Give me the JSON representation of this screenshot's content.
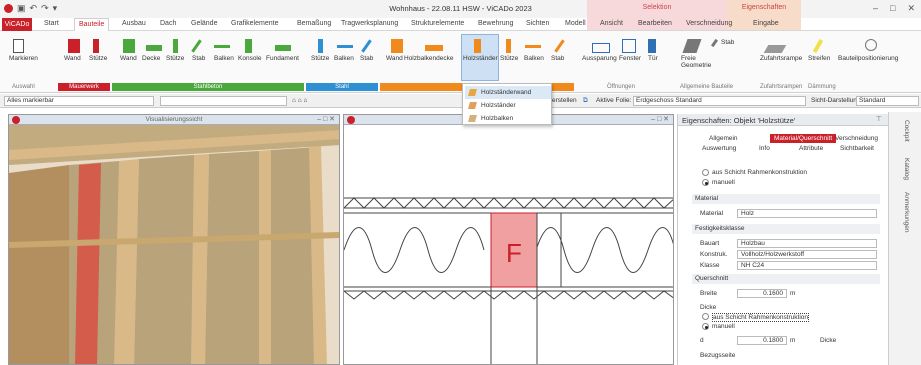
{
  "window": {
    "title": "Wohnhaus - 22.08.11 HSW - ViCADo 2023",
    "controls": [
      "–",
      "□",
      "✕"
    ]
  },
  "qat_icons": [
    "app-logo-icon",
    "save-icon",
    "undo-icon",
    "redo-icon",
    "customize-icon"
  ],
  "context_tabs": {
    "selektion": "Selektion",
    "eigenschaften": "Eigenschaften"
  },
  "tabs": [
    "ViCADo",
    "Start",
    "Bauteile",
    "Ausbau",
    "Dach",
    "Gelände",
    "Grafikelemente",
    "Bemaßung",
    "Tragwerksplanung",
    "Strukturelemente",
    "Bewehrung",
    "Sichten",
    "Modell",
    "Ansicht",
    "Bearbeiten",
    "Verschneidung",
    "Eingabe"
  ],
  "active_tab": "Bauteile",
  "ribbon": {
    "buttons": [
      "Markieren",
      "Wand",
      "Stütze",
      "Wand",
      "Decke",
      "Stütze",
      "Stab",
      "Balken",
      "Konsole",
      "Fundament",
      "Stütze",
      "Balken",
      "Stab",
      "Wand",
      "Holzbalkendecke",
      "Holzständer",
      "Stütze",
      "Balken",
      "Stab",
      "Aussparung",
      "Fenster",
      "Tür",
      "Freie Geometrie",
      "Stab",
      "Zufahrtsrampe",
      "Streifen",
      "Bauteilpositionierung"
    ],
    "groups": [
      "Auswahl",
      "Mauerwerk",
      "Stahlbeton",
      "Stahl",
      "Holz",
      "Öffnungen",
      "Allgemeine Bauteile",
      "Zufahrtsrampen",
      "Dämmung"
    ],
    "group_colors": {
      "mauerwerk": "#c9202a",
      "stahlbeton": "#4aa83c",
      "stahl": "#2f8fd3",
      "holz": "#f08a1c"
    }
  },
  "dropdown": {
    "items": [
      "Holzständerwand",
      "Holzständer",
      "Holzbalken"
    ],
    "highlighted": 0
  },
  "options": {
    "filter": "Alles markierbar",
    "folie_label": "Aktive Folie:",
    "folie_value": "Erdgeschoss Standard",
    "sicht_label": "Sicht-Darstellung:",
    "sicht_value": "Standard",
    "erstellen": "erstellen"
  },
  "pane_left": {
    "title": "Visualisierungssicht"
  },
  "pane_mid": {
    "title": "",
    "label": "F"
  },
  "properties": {
    "title": "Eigenschaften: Objekt 'Holzstütze'",
    "tabs": [
      "Allgemein",
      "Material/Querschnitt",
      "Verschneidung",
      "Auswertung",
      "Info",
      "Attribute",
      "Sichtbarkeit"
    ],
    "active_tab": "Material/Querschnitt",
    "source_options": [
      "aus Schicht Rahmenkonstruktion",
      "manuell"
    ],
    "material_section": "Material",
    "material_label": "Material",
    "material_value": "Holz",
    "festigkeit_section": "Festigkeitsklasse",
    "bauart_label": "Bauart",
    "bauart_value": "Holzbau",
    "konstruk_label": "Konstruk.",
    "konstruk_value": "Vollholz/Holzwerkstoff",
    "klasse_label": "Klasse",
    "klasse_value": "NH C24",
    "querschnitt_section": "Querschnitt",
    "breite_label": "Breite",
    "breite_value": "0.1600",
    "unit": "m",
    "dicke_label": "Dicke",
    "dicke_options": [
      "aus Schicht Rahmenkonstruktion",
      "manuell"
    ],
    "d_label": "d",
    "d_value": "0.1800",
    "d_extra": "Dicke",
    "bezug_label": "Bezugsseite"
  },
  "side_tabs": [
    "Cockpit",
    "Katalog",
    "Anmerkungen"
  ]
}
